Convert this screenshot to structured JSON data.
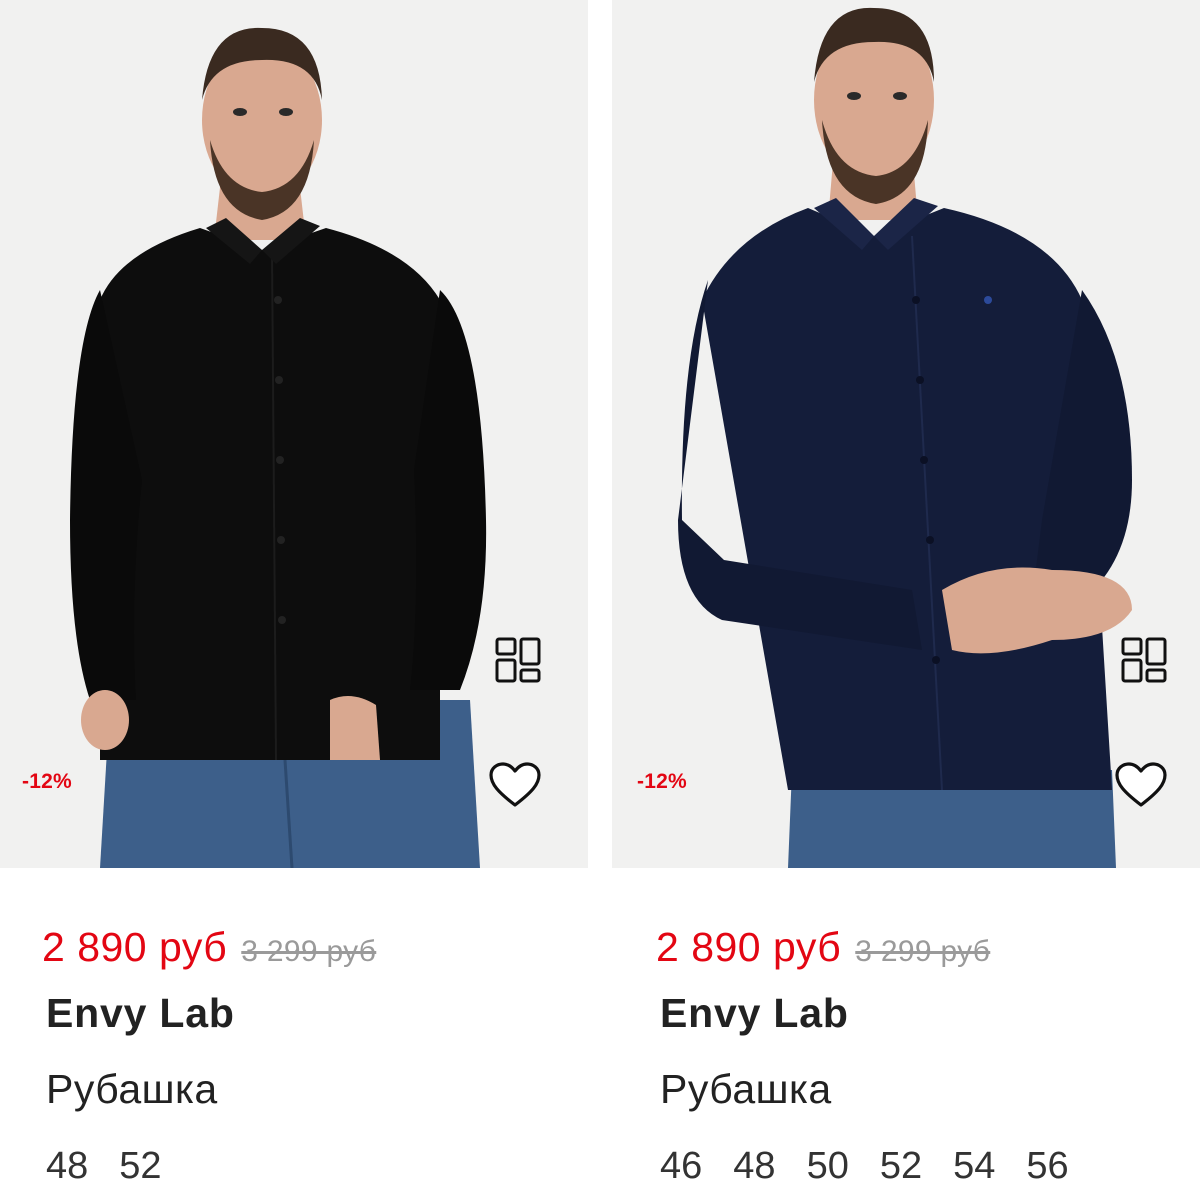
{
  "products": [
    {
      "discount_badge": "-12%",
      "price_new": "2 890 руб",
      "price_old": "3 299 руб",
      "brand": "Envy Lab",
      "type": "Рубашка",
      "sizes": [
        "48",
        "52"
      ],
      "shirt_color": "#0d0d0d",
      "icons": [
        "look-grid-icon",
        "heart-icon"
      ]
    },
    {
      "discount_badge": "-12%",
      "price_new": "2 890 руб",
      "price_old": "3 299 руб",
      "brand": "Envy Lab",
      "type": "Рубашка",
      "sizes": [
        "46",
        "48",
        "50",
        "52",
        "54",
        "56"
      ],
      "shirt_color": "#141d3a",
      "icons": [
        "look-grid-icon",
        "heart-icon"
      ]
    }
  ],
  "colors": {
    "price_accent": "#e30613",
    "old_price": "#9a9a9a",
    "text": "#222222",
    "photo_bg": "#f1f1f0",
    "jeans": "#3d5f8a",
    "skin": "#d9a890"
  }
}
